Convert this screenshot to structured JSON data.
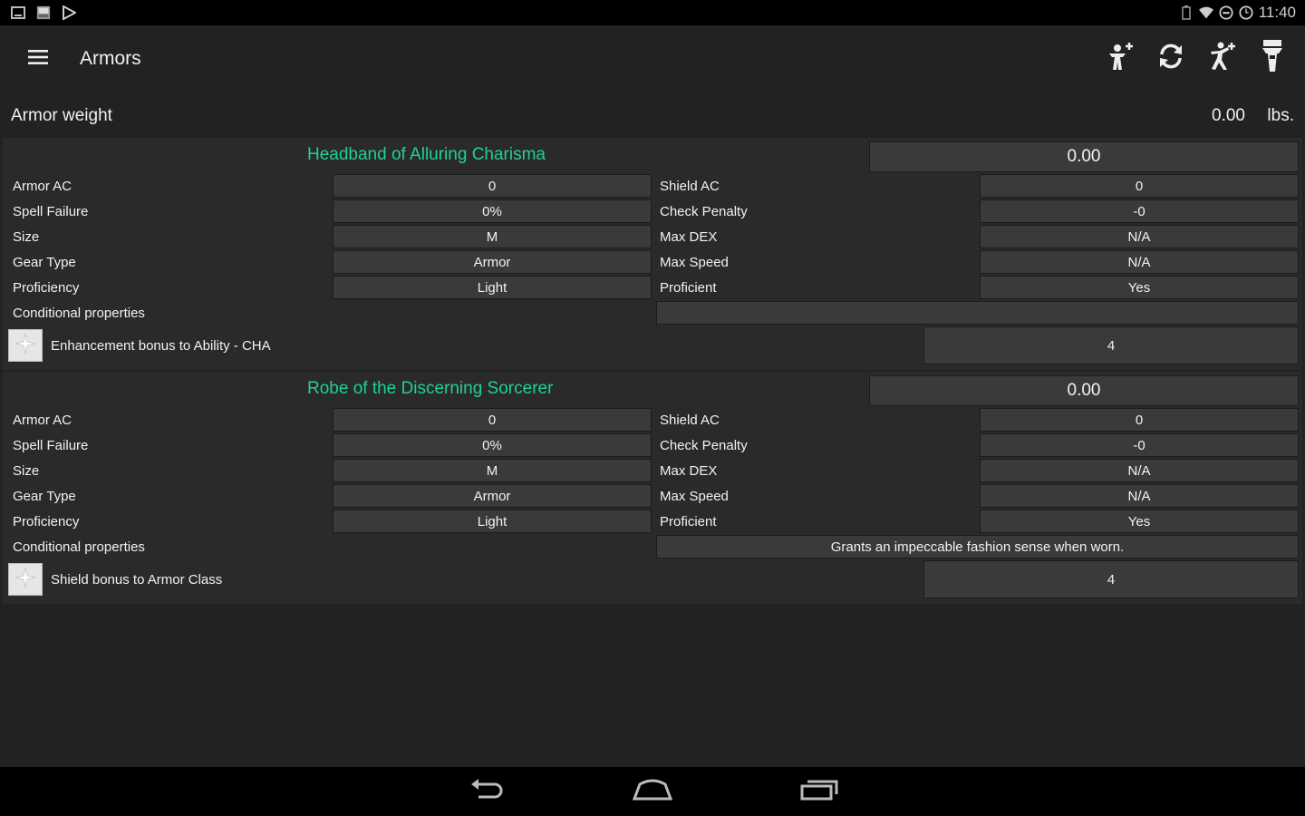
{
  "status_bar": {
    "time": "11:40",
    "left_icons": [
      "tablet-icon",
      "image-icon",
      "play-store-icon"
    ],
    "right_icons": [
      "battery-icon",
      "wifi-icon",
      "dnd-icon",
      "alarm-icon"
    ]
  },
  "action_bar": {
    "title": "Armors",
    "actions": [
      "add-character-icon",
      "sync-icon",
      "add-stat-icon",
      "equipment-icon"
    ]
  },
  "armor_weight": {
    "label": "Armor weight",
    "value": "0.00",
    "unit": "lbs."
  },
  "armors": [
    {
      "name": "Headband of Alluring Charisma",
      "weight": "0.00",
      "left_labels": [
        "Armor AC",
        "Spell Failure",
        "Size",
        "Gear Type",
        "Proficiency"
      ],
      "left_values": [
        "0",
        "0%",
        "M",
        "Armor",
        "Light"
      ],
      "right_labels": [
        "Shield AC",
        "Check Penalty",
        "Max DEX",
        "Max Speed",
        "Proficient"
      ],
      "right_values": [
        "0",
        "-0",
        "N/A",
        "N/A",
        "Yes"
      ],
      "conditional_label": "Conditional properties",
      "conditional_value": "",
      "bonus_label": "Enhancement bonus to Ability - CHA",
      "bonus_value": "4"
    },
    {
      "name": "Robe of the Discerning Sorcerer",
      "weight": "0.00",
      "left_labels": [
        "Armor AC",
        "Spell Failure",
        "Size",
        "Gear Type",
        "Proficiency"
      ],
      "left_values": [
        "0",
        "0%",
        "M",
        "Armor",
        "Light"
      ],
      "right_labels": [
        "Shield AC",
        "Check Penalty",
        "Max DEX",
        "Max Speed",
        "Proficient"
      ],
      "right_values": [
        "0",
        "-0",
        "N/A",
        "N/A",
        "Yes"
      ],
      "conditional_label": "Conditional properties",
      "conditional_value": "Grants an impeccable fashion sense when worn.",
      "bonus_label": "Shield bonus to Armor Class",
      "bonus_value": "4"
    }
  ],
  "nav_bar": [
    "back-icon",
    "home-icon",
    "recents-icon"
  ],
  "colors": {
    "accent": "#1fd196",
    "background": "#222222",
    "card": "#2a2a2a",
    "field": "#3a3a3a"
  }
}
